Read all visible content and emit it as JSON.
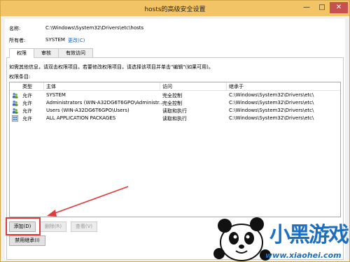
{
  "window": {
    "title": "hosts的高级安全设置",
    "minimize": "—",
    "maximize": "□",
    "close": "✕"
  },
  "name_label": "名称:",
  "name_value": "C:\\Windows\\System32\\Drivers\\etc\\hosts",
  "owner_label": "所有者:",
  "owner_value": "SYSTEM",
  "change_link": "更改(C)",
  "tabs": [
    {
      "label": "权限"
    },
    {
      "label": "审核"
    },
    {
      "label": "有效访问"
    }
  ],
  "info_text": "如需其他信息，请双击权限项目。若要修改权限项目，请选择该项目并单击\"编辑\"(如果可用)。",
  "perm_entries_label": "权限条目:",
  "columns": {
    "type": "类型",
    "principal": "主体",
    "access": "访问",
    "inherit": "继承于"
  },
  "rows": [
    {
      "type": "允许",
      "principal": "SYSTEM",
      "access": "完全控制",
      "inherit": "C:\\Windows\\System32\\Drivers\\etc\\",
      "icon": "user-group-icon"
    },
    {
      "type": "允许",
      "principal": "Administrators (WIN-A32DG6T6GPO\\Administr...",
      "access": "完全控制",
      "inherit": "C:\\Windows\\System32\\Drivers\\etc\\",
      "icon": "user-group-icon"
    },
    {
      "type": "允许",
      "principal": "Users (WIN-A32DG6T6GPO\\Users)",
      "access": "读取和执行",
      "inherit": "C:\\Windows\\System32\\Drivers\\etc\\",
      "icon": "user-group-icon"
    },
    {
      "type": "允许",
      "principal": "ALL APPLICATION PACKAGES",
      "access": "读取和执行",
      "inherit": "C:\\Windows\\System32\\Drivers\\etc\\",
      "icon": "app-package-icon"
    }
  ],
  "buttons": {
    "add": "添加(D)",
    "remove": "删除(R)",
    "view": "查看(V)",
    "disable_inherit": "禁用继承(I)"
  },
  "watermark": {
    "brand": "小黑游戏",
    "url": "www.xiaohei.com"
  },
  "colors": {
    "titlebar": "#f2c465",
    "highlight": "#e23a3a",
    "link": "#1a5fb4"
  }
}
